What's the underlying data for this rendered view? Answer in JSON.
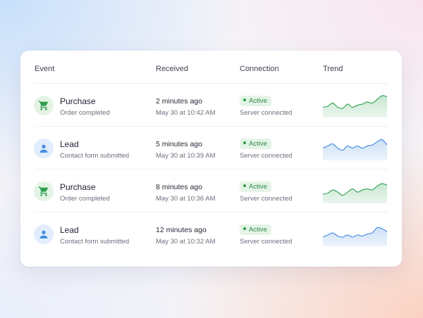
{
  "table": {
    "columns": {
      "event": "Event",
      "received": "Received",
      "connection": "Connection",
      "trend": "Trend"
    },
    "rows": [
      {
        "event_type": "purchase",
        "icon": "shopping-cart-icon",
        "title": "Purchase",
        "subtitle": "Order completed",
        "received_relative": "2 minutes ago",
        "received_date": "May 30 at 10:42 AM",
        "status": "Active",
        "connection_detail": "Server connected",
        "trend_color": "#3aa85a",
        "trend": [
          0.35,
          0.4,
          0.55,
          0.35,
          0.3,
          0.5,
          0.35,
          0.45,
          0.5,
          0.6,
          0.55,
          0.72,
          0.9,
          0.85
        ]
      },
      {
        "event_type": "lead",
        "icon": "user-icon",
        "title": "Lead",
        "subtitle": "Contact form submitted",
        "received_relative": "5 minutes ago",
        "received_date": "May 30 at 10:39 AM",
        "status": "Active",
        "connection_detail": "Server connected",
        "trend_color": "#4a8fe0",
        "trend": [
          0.45,
          0.55,
          0.65,
          0.45,
          0.35,
          0.55,
          0.45,
          0.55,
          0.45,
          0.55,
          0.6,
          0.75,
          0.85,
          0.6
        ]
      },
      {
        "event_type": "purchase",
        "icon": "shopping-cart-icon",
        "title": "Purchase",
        "subtitle": "Order completed",
        "received_relative": "8 minutes ago",
        "received_date": "May 30 at 10:36 AM",
        "status": "Active",
        "connection_detail": "Server connected",
        "trend_color": "#3aa85a",
        "trend": [
          0.3,
          0.35,
          0.5,
          0.4,
          0.25,
          0.4,
          0.55,
          0.4,
          0.5,
          0.55,
          0.5,
          0.68,
          0.8,
          0.72
        ]
      },
      {
        "event_type": "lead",
        "icon": "user-icon",
        "title": "Lead",
        "subtitle": "Contact form submitted",
        "received_relative": "12 minutes ago",
        "received_date": "May 30 at 10:32 AM",
        "status": "Active",
        "connection_detail": "Server connected",
        "trend_color": "#4a8fe0",
        "trend": [
          0.3,
          0.4,
          0.5,
          0.35,
          0.3,
          0.4,
          0.3,
          0.4,
          0.35,
          0.45,
          0.5,
          0.75,
          0.7,
          0.55
        ]
      }
    ]
  },
  "colors": {
    "green": "#3aa85a",
    "blue": "#4a8fe0",
    "active_badge_bg": "#e4f4e7",
    "active_badge_text": "#2e8a45"
  }
}
